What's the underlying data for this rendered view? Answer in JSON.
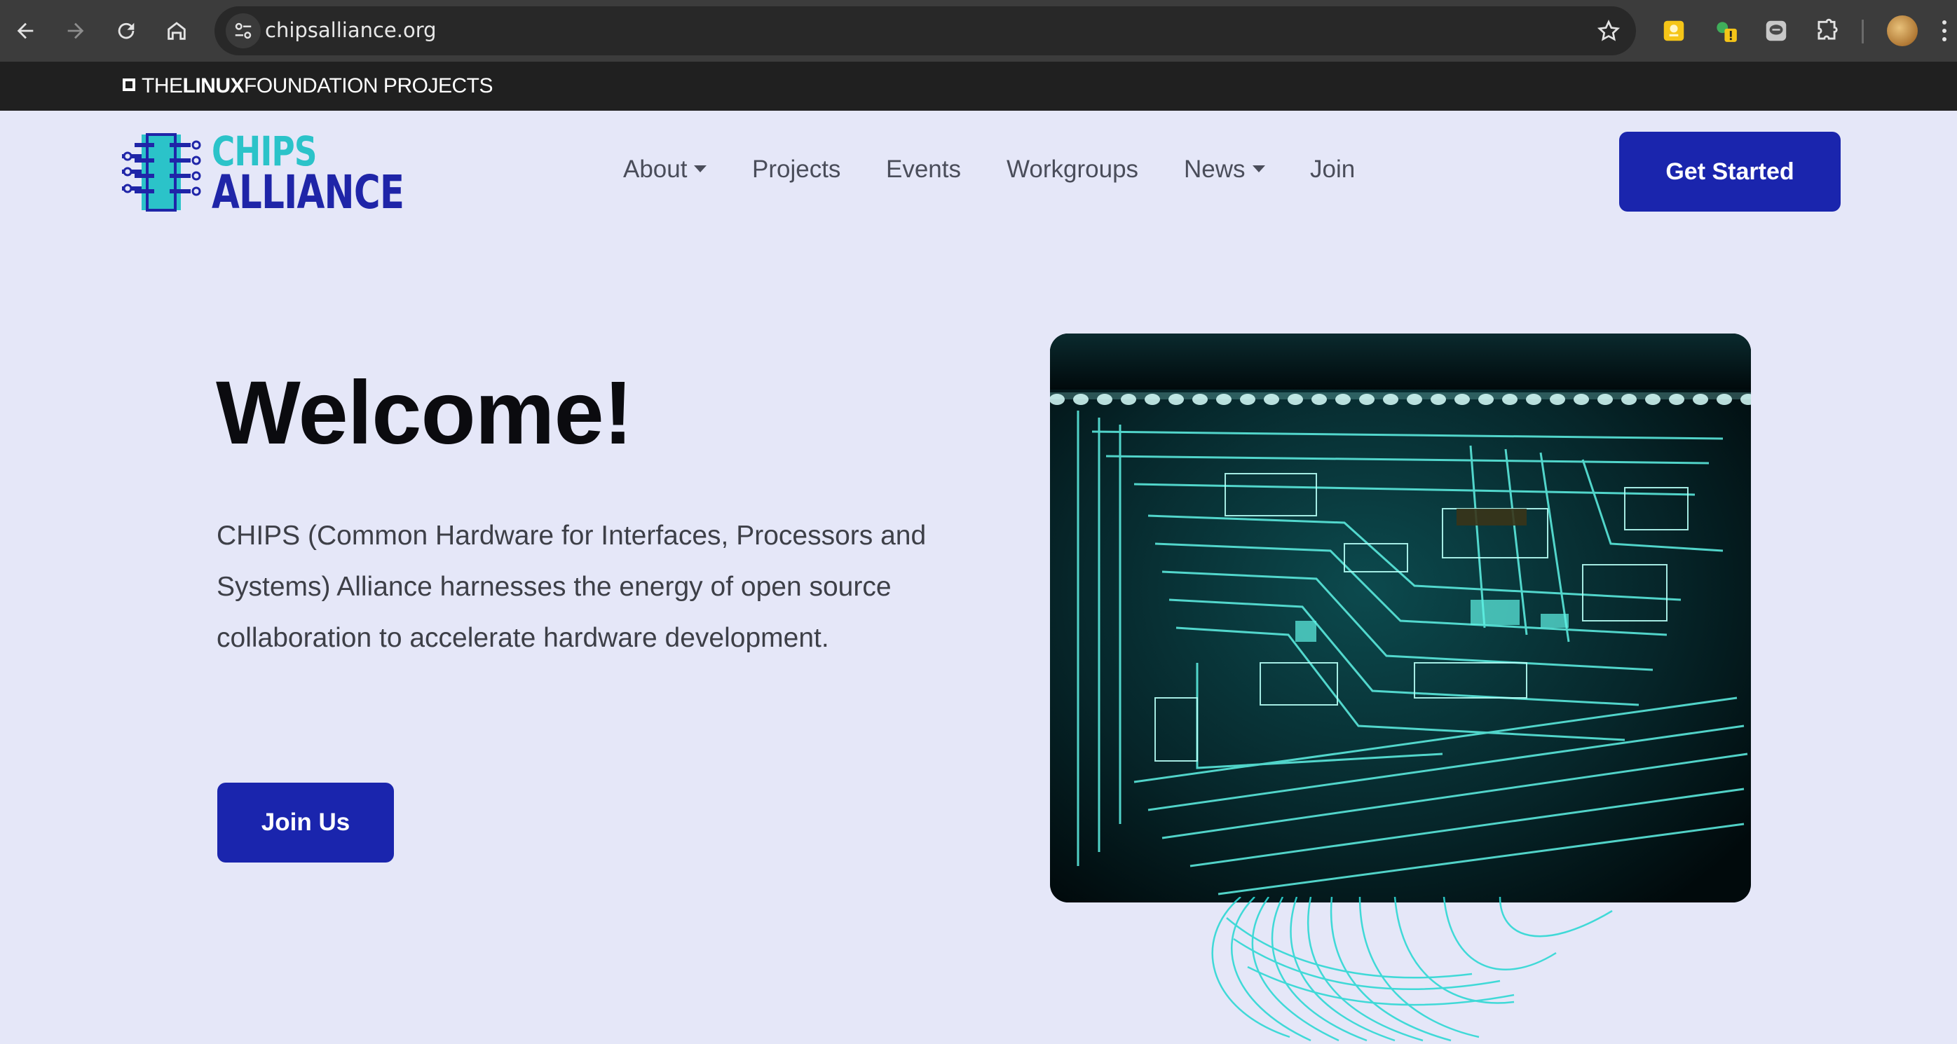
{
  "browser": {
    "url": "chipsalliance.org",
    "icons": {
      "back": "arrow-left-icon",
      "forward": "arrow-right-icon",
      "reload": "reload-icon",
      "home": "home-icon",
      "site_info": "tune-icon",
      "bookmark": "star-icon",
      "extensions": [
        "yellow-extension-icon",
        "warning-extension-icon",
        "chat-extension-icon",
        "puzzle-icon"
      ],
      "profile": "avatar-icon",
      "menu": "kebab-icon"
    }
  },
  "lf_bar": {
    "prefix": "THE",
    "bold": "LINUX",
    "suffix": "FOUNDATION PROJECTS"
  },
  "header": {
    "logo": {
      "line1": "CHIPS",
      "line2": "ALLIANCE"
    },
    "nav": [
      {
        "label": "About",
        "dropdown": true
      },
      {
        "label": "Projects",
        "dropdown": false
      },
      {
        "label": "Events",
        "dropdown": false
      },
      {
        "label": "Workgroups",
        "dropdown": false
      },
      {
        "label": "News",
        "dropdown": true
      },
      {
        "label": "Join",
        "dropdown": false
      }
    ],
    "cta": "Get Started"
  },
  "hero": {
    "title": "Welcome!",
    "body": "CHIPS (Common Hardware for Interfaces, Processors and Systems) Alliance harnesses the energy of open source collaboration to accelerate hardware development.",
    "cta": "Join Us"
  },
  "colors": {
    "page_bg": "#e5e7f8",
    "primary": "#1a25ad",
    "accent_teal": "#2bc3c9",
    "chrome_bg": "#3c3c3c",
    "lf_strip": "#202020"
  }
}
